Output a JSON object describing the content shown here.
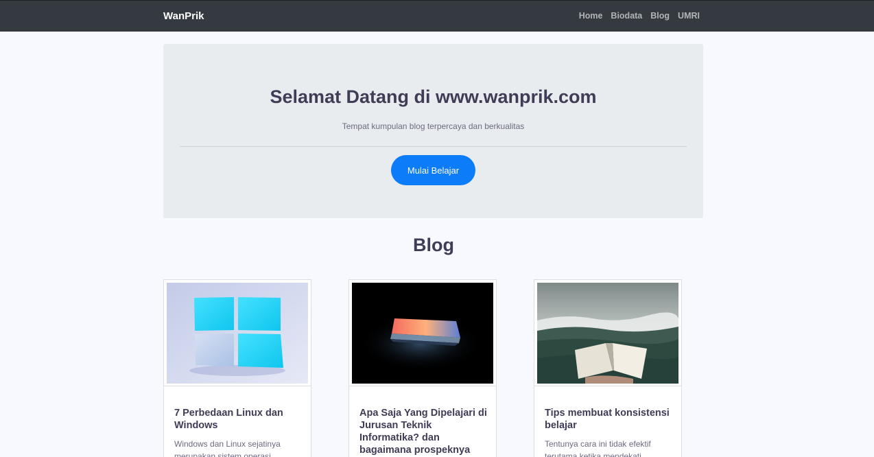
{
  "navbar": {
    "brand": "WanPrik",
    "links": [
      "Home",
      "Biodata",
      "Blog",
      "UMRI"
    ]
  },
  "hero": {
    "title": "Selamat Datang di www.wanprik.com",
    "subtitle": "Tempat kumpulan blog terpercaya dan berkualitas",
    "button_label": "Mulai Belajar"
  },
  "blog": {
    "section_title": "Blog",
    "cards": [
      {
        "image_icon": "windows-logo-image",
        "title": "7 Perbedaan Linux dan Windows",
        "excerpt": "Windows dan Linux sejatinya merupakan sistem operasi"
      },
      {
        "image_icon": "laptop-dark-image",
        "title": "Apa Saja Yang Dipelajari di Jurusan Teknik Informatika? dan bagaimana prospeknya",
        "excerpt": ""
      },
      {
        "image_icon": "open-book-landscape-image",
        "title": "Tips membuat konsistensi belajar",
        "excerpt": "Tentunya cara ini tidak efektif terutama ketika mendekati"
      }
    ]
  },
  "colors": {
    "navbar_bg": "#343a40",
    "page_bg": "#f8f9fe",
    "jumbotron_bg": "#e9ecef",
    "primary_button": "#0d7cf8",
    "heading_text": "#3f3d56"
  }
}
